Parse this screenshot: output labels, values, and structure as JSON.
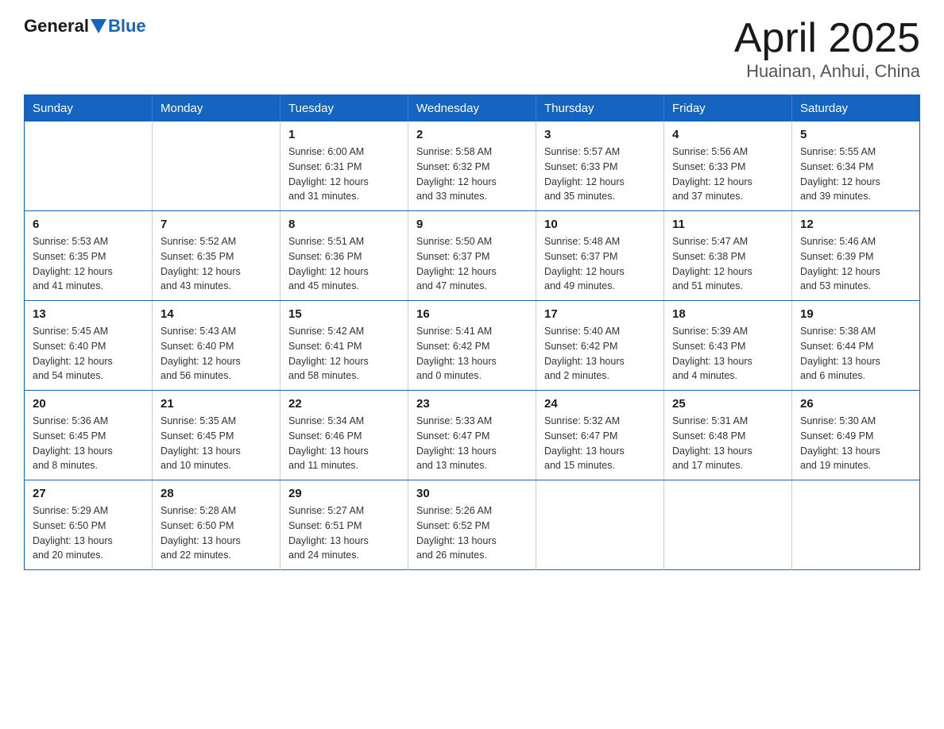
{
  "logo": {
    "general": "General",
    "blue": "Blue"
  },
  "title": "April 2025",
  "subtitle": "Huainan, Anhui, China",
  "days_of_week": [
    "Sunday",
    "Monday",
    "Tuesday",
    "Wednesday",
    "Thursday",
    "Friday",
    "Saturday"
  ],
  "weeks": [
    [
      {
        "day": "",
        "info": ""
      },
      {
        "day": "",
        "info": ""
      },
      {
        "day": "1",
        "info": "Sunrise: 6:00 AM\nSunset: 6:31 PM\nDaylight: 12 hours\nand 31 minutes."
      },
      {
        "day": "2",
        "info": "Sunrise: 5:58 AM\nSunset: 6:32 PM\nDaylight: 12 hours\nand 33 minutes."
      },
      {
        "day": "3",
        "info": "Sunrise: 5:57 AM\nSunset: 6:33 PM\nDaylight: 12 hours\nand 35 minutes."
      },
      {
        "day": "4",
        "info": "Sunrise: 5:56 AM\nSunset: 6:33 PM\nDaylight: 12 hours\nand 37 minutes."
      },
      {
        "day": "5",
        "info": "Sunrise: 5:55 AM\nSunset: 6:34 PM\nDaylight: 12 hours\nand 39 minutes."
      }
    ],
    [
      {
        "day": "6",
        "info": "Sunrise: 5:53 AM\nSunset: 6:35 PM\nDaylight: 12 hours\nand 41 minutes."
      },
      {
        "day": "7",
        "info": "Sunrise: 5:52 AM\nSunset: 6:35 PM\nDaylight: 12 hours\nand 43 minutes."
      },
      {
        "day": "8",
        "info": "Sunrise: 5:51 AM\nSunset: 6:36 PM\nDaylight: 12 hours\nand 45 minutes."
      },
      {
        "day": "9",
        "info": "Sunrise: 5:50 AM\nSunset: 6:37 PM\nDaylight: 12 hours\nand 47 minutes."
      },
      {
        "day": "10",
        "info": "Sunrise: 5:48 AM\nSunset: 6:37 PM\nDaylight: 12 hours\nand 49 minutes."
      },
      {
        "day": "11",
        "info": "Sunrise: 5:47 AM\nSunset: 6:38 PM\nDaylight: 12 hours\nand 51 minutes."
      },
      {
        "day": "12",
        "info": "Sunrise: 5:46 AM\nSunset: 6:39 PM\nDaylight: 12 hours\nand 53 minutes."
      }
    ],
    [
      {
        "day": "13",
        "info": "Sunrise: 5:45 AM\nSunset: 6:40 PM\nDaylight: 12 hours\nand 54 minutes."
      },
      {
        "day": "14",
        "info": "Sunrise: 5:43 AM\nSunset: 6:40 PM\nDaylight: 12 hours\nand 56 minutes."
      },
      {
        "day": "15",
        "info": "Sunrise: 5:42 AM\nSunset: 6:41 PM\nDaylight: 12 hours\nand 58 minutes."
      },
      {
        "day": "16",
        "info": "Sunrise: 5:41 AM\nSunset: 6:42 PM\nDaylight: 13 hours\nand 0 minutes."
      },
      {
        "day": "17",
        "info": "Sunrise: 5:40 AM\nSunset: 6:42 PM\nDaylight: 13 hours\nand 2 minutes."
      },
      {
        "day": "18",
        "info": "Sunrise: 5:39 AM\nSunset: 6:43 PM\nDaylight: 13 hours\nand 4 minutes."
      },
      {
        "day": "19",
        "info": "Sunrise: 5:38 AM\nSunset: 6:44 PM\nDaylight: 13 hours\nand 6 minutes."
      }
    ],
    [
      {
        "day": "20",
        "info": "Sunrise: 5:36 AM\nSunset: 6:45 PM\nDaylight: 13 hours\nand 8 minutes."
      },
      {
        "day": "21",
        "info": "Sunrise: 5:35 AM\nSunset: 6:45 PM\nDaylight: 13 hours\nand 10 minutes."
      },
      {
        "day": "22",
        "info": "Sunrise: 5:34 AM\nSunset: 6:46 PM\nDaylight: 13 hours\nand 11 minutes."
      },
      {
        "day": "23",
        "info": "Sunrise: 5:33 AM\nSunset: 6:47 PM\nDaylight: 13 hours\nand 13 minutes."
      },
      {
        "day": "24",
        "info": "Sunrise: 5:32 AM\nSunset: 6:47 PM\nDaylight: 13 hours\nand 15 minutes."
      },
      {
        "day": "25",
        "info": "Sunrise: 5:31 AM\nSunset: 6:48 PM\nDaylight: 13 hours\nand 17 minutes."
      },
      {
        "day": "26",
        "info": "Sunrise: 5:30 AM\nSunset: 6:49 PM\nDaylight: 13 hours\nand 19 minutes."
      }
    ],
    [
      {
        "day": "27",
        "info": "Sunrise: 5:29 AM\nSunset: 6:50 PM\nDaylight: 13 hours\nand 20 minutes."
      },
      {
        "day": "28",
        "info": "Sunrise: 5:28 AM\nSunset: 6:50 PM\nDaylight: 13 hours\nand 22 minutes."
      },
      {
        "day": "29",
        "info": "Sunrise: 5:27 AM\nSunset: 6:51 PM\nDaylight: 13 hours\nand 24 minutes."
      },
      {
        "day": "30",
        "info": "Sunrise: 5:26 AM\nSunset: 6:52 PM\nDaylight: 13 hours\nand 26 minutes."
      },
      {
        "day": "",
        "info": ""
      },
      {
        "day": "",
        "info": ""
      },
      {
        "day": "",
        "info": ""
      }
    ]
  ]
}
